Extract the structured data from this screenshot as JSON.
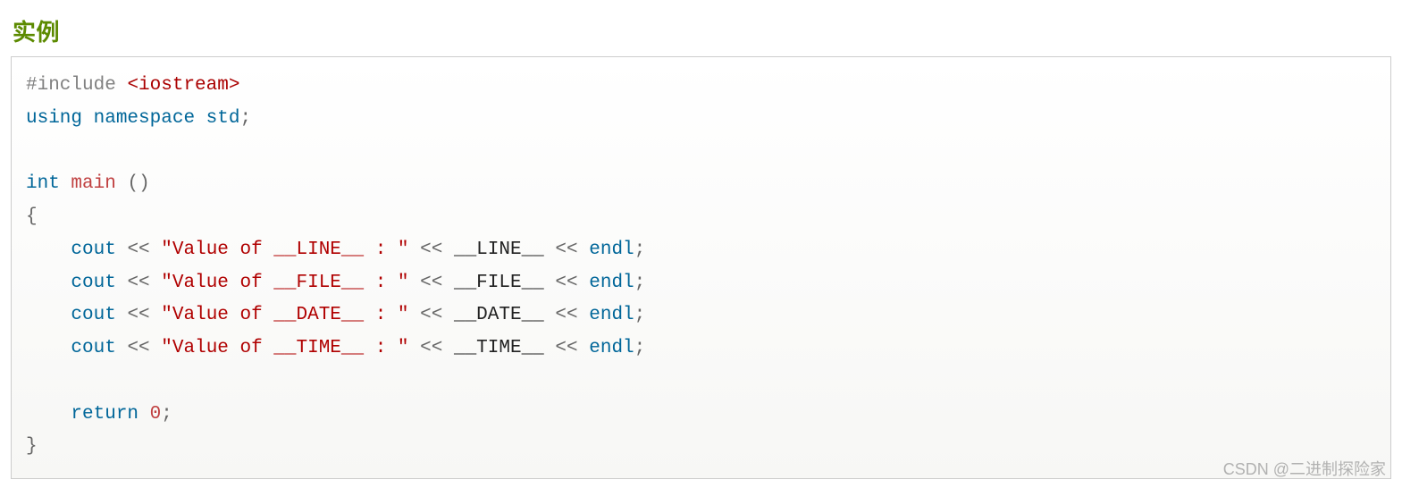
{
  "heading": "实例",
  "watermark": "CSDN @二进制探险家",
  "code": {
    "tokens": [
      [
        {
          "t": "#include",
          "c": "dir"
        },
        {
          "t": " ",
          "c": "pun"
        },
        {
          "t": "<iostream>",
          "c": "hdr"
        }
      ],
      [
        {
          "t": "using",
          "c": "kw"
        },
        {
          "t": " ",
          "c": "pun"
        },
        {
          "t": "namespace",
          "c": "kw"
        },
        {
          "t": " ",
          "c": "pun"
        },
        {
          "t": "std",
          "c": "kw"
        },
        {
          "t": ";",
          "c": "pun"
        }
      ],
      [],
      [
        {
          "t": "int",
          "c": "kw"
        },
        {
          "t": " ",
          "c": "pun"
        },
        {
          "t": "main",
          "c": "fn"
        },
        {
          "t": " ",
          "c": "pun"
        },
        {
          "t": "(",
          "c": "pun"
        },
        {
          "t": ")",
          "c": "pun"
        }
      ],
      [
        {
          "t": "{",
          "c": "pun"
        }
      ],
      [
        {
          "t": "    ",
          "c": "pun"
        },
        {
          "t": "cout",
          "c": "kw"
        },
        {
          "t": " ",
          "c": "pun"
        },
        {
          "t": "<<",
          "c": "pun"
        },
        {
          "t": " ",
          "c": "pun"
        },
        {
          "t": "\"Value of __LINE__ : \"",
          "c": "str"
        },
        {
          "t": " ",
          "c": "pun"
        },
        {
          "t": "<<",
          "c": "pun"
        },
        {
          "t": " ",
          "c": "pun"
        },
        {
          "t": "__LINE__",
          "c": "plain"
        },
        {
          "t": " ",
          "c": "pun"
        },
        {
          "t": "<<",
          "c": "pun"
        },
        {
          "t": " ",
          "c": "pun"
        },
        {
          "t": "endl",
          "c": "kw"
        },
        {
          "t": ";",
          "c": "pun"
        }
      ],
      [
        {
          "t": "    ",
          "c": "pun"
        },
        {
          "t": "cout",
          "c": "kw"
        },
        {
          "t": " ",
          "c": "pun"
        },
        {
          "t": "<<",
          "c": "pun"
        },
        {
          "t": " ",
          "c": "pun"
        },
        {
          "t": "\"Value of __FILE__ : \"",
          "c": "str"
        },
        {
          "t": " ",
          "c": "pun"
        },
        {
          "t": "<<",
          "c": "pun"
        },
        {
          "t": " ",
          "c": "pun"
        },
        {
          "t": "__FILE__",
          "c": "plain"
        },
        {
          "t": " ",
          "c": "pun"
        },
        {
          "t": "<<",
          "c": "pun"
        },
        {
          "t": " ",
          "c": "pun"
        },
        {
          "t": "endl",
          "c": "kw"
        },
        {
          "t": ";",
          "c": "pun"
        }
      ],
      [
        {
          "t": "    ",
          "c": "pun"
        },
        {
          "t": "cout",
          "c": "kw"
        },
        {
          "t": " ",
          "c": "pun"
        },
        {
          "t": "<<",
          "c": "pun"
        },
        {
          "t": " ",
          "c": "pun"
        },
        {
          "t": "\"Value of __DATE__ : \"",
          "c": "str"
        },
        {
          "t": " ",
          "c": "pun"
        },
        {
          "t": "<<",
          "c": "pun"
        },
        {
          "t": " ",
          "c": "pun"
        },
        {
          "t": "__DATE__",
          "c": "plain"
        },
        {
          "t": " ",
          "c": "pun"
        },
        {
          "t": "<<",
          "c": "pun"
        },
        {
          "t": " ",
          "c": "pun"
        },
        {
          "t": "endl",
          "c": "kw"
        },
        {
          "t": ";",
          "c": "pun"
        }
      ],
      [
        {
          "t": "    ",
          "c": "pun"
        },
        {
          "t": "cout",
          "c": "kw"
        },
        {
          "t": " ",
          "c": "pun"
        },
        {
          "t": "<<",
          "c": "pun"
        },
        {
          "t": " ",
          "c": "pun"
        },
        {
          "t": "\"Value of __TIME__ : \"",
          "c": "str"
        },
        {
          "t": " ",
          "c": "pun"
        },
        {
          "t": "<<",
          "c": "pun"
        },
        {
          "t": " ",
          "c": "pun"
        },
        {
          "t": "__TIME__",
          "c": "plain"
        },
        {
          "t": " ",
          "c": "pun"
        },
        {
          "t": "<<",
          "c": "pun"
        },
        {
          "t": " ",
          "c": "pun"
        },
        {
          "t": "endl",
          "c": "kw"
        },
        {
          "t": ";",
          "c": "pun"
        }
      ],
      [],
      [
        {
          "t": "    ",
          "c": "pun"
        },
        {
          "t": "return",
          "c": "kw"
        },
        {
          "t": " ",
          "c": "pun"
        },
        {
          "t": "0",
          "c": "num"
        },
        {
          "t": ";",
          "c": "pun"
        }
      ],
      [
        {
          "t": "}",
          "c": "pun"
        }
      ]
    ]
  }
}
